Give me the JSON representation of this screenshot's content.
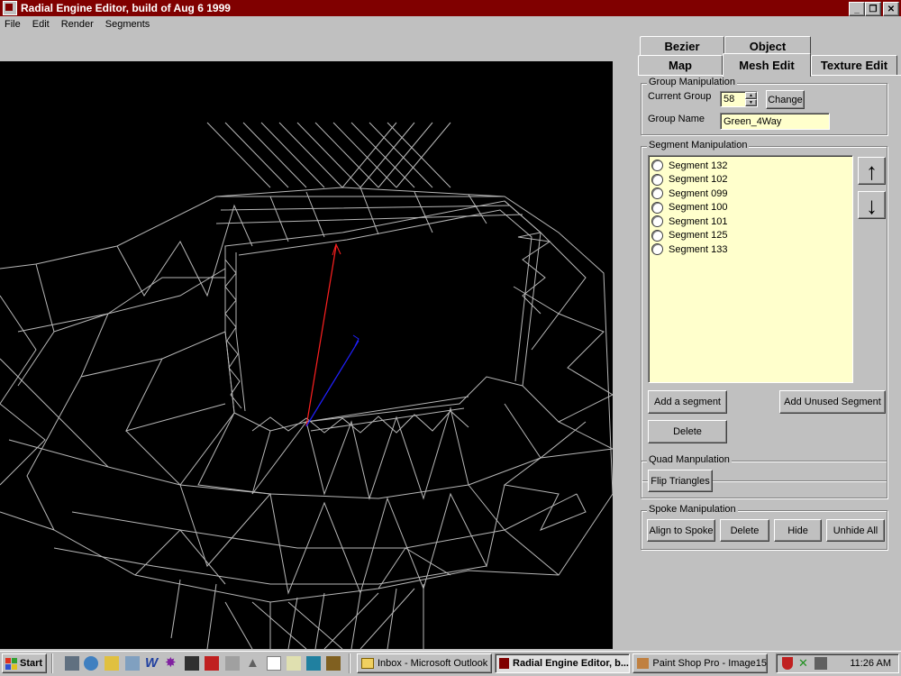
{
  "window": {
    "title": "Radial Engine Editor, build of Aug  6 1999"
  },
  "menu": [
    "File",
    "Edit",
    "Render",
    "Segments"
  ],
  "tabs": {
    "row1": [
      "Bezier",
      "Object"
    ],
    "row2": [
      "Map",
      "Mesh Edit",
      "Texture Edit"
    ],
    "active": "Mesh Edit"
  },
  "group_manipulation": {
    "title": "Group Manipulation",
    "current_group_label": "Current Group",
    "current_group_value": "58",
    "change_label": "Change",
    "group_name_label": "Group Name",
    "group_name_value": "Green_4Way"
  },
  "segment_manipulation": {
    "title": "Segment Manipulation",
    "segments": [
      "Segment 132",
      "Segment 102",
      "Segment 099",
      "Segment 100",
      "Segment 101",
      "Segment 125",
      "Segment 133"
    ],
    "up_arrow": "↑",
    "down_arrow": "↓",
    "add_segment_label": "Add a segment",
    "add_unused_label": "Add Unused Segment",
    "delete_label": "Delete"
  },
  "quad_manipulation": {
    "title": "Quad Manpulation",
    "flip_label": "Flip Triangles"
  },
  "spoke_manipulation": {
    "title": "Spoke Manipulation",
    "align_label": "Align to Spoke",
    "delete_label": "Delete",
    "hide_label": "Hide",
    "unhide_label": "Unhide All"
  },
  "taskbar": {
    "start_label": "Start",
    "tasks": [
      "Inbox - Microsoft Outlook",
      "Radial Engine Editor, b...",
      "Paint Shop Pro - Image15"
    ],
    "clock": "11:26 AM"
  },
  "colors": {
    "titlebar": "#800000",
    "list_bg": "#ffffcc",
    "viewport_bg": "#000000",
    "axis_red": "#ff2020",
    "axis_blue": "#2020ff"
  }
}
